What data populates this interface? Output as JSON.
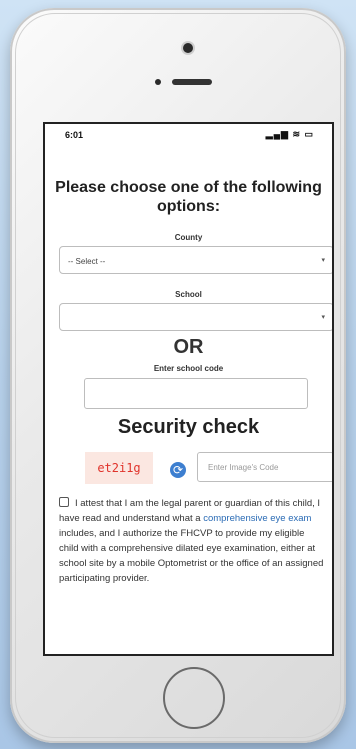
{
  "status_bar": {
    "time": "6:01",
    "icons": "▂▄▆ ≋ ▭"
  },
  "form": {
    "heading": "Please choose one of the following options:",
    "county_label": "County",
    "county_value": "-- Select --",
    "school_label": "School",
    "school_value": "",
    "or_text": "OR",
    "school_code_label": "Enter school code",
    "school_code_value": ""
  },
  "security": {
    "title": "Security check",
    "captcha_text": "et2i1g",
    "image_code_placeholder": "Enter Image's Code"
  },
  "attestation": {
    "text_before": "I attest that I am the legal parent or guardian of this child, I have read and understand what a ",
    "link_text": "comprehensive eye exam",
    "text_after": " includes, and I authorize the FHCVP to provide my eligible child with a comprehensive dilated eye examination, either at school site by a mobile Optometrist or the office of an assigned participating provider."
  },
  "icons": {
    "caret": "chevron-down-icon",
    "refresh": "refresh-icon",
    "checkbox": "checkbox-icon"
  },
  "colors": {
    "captcha_text": "#e0332b",
    "captcha_bg": "#fbe7e1",
    "link": "#2a6bb5",
    "refresh": "#3d7fd0"
  }
}
